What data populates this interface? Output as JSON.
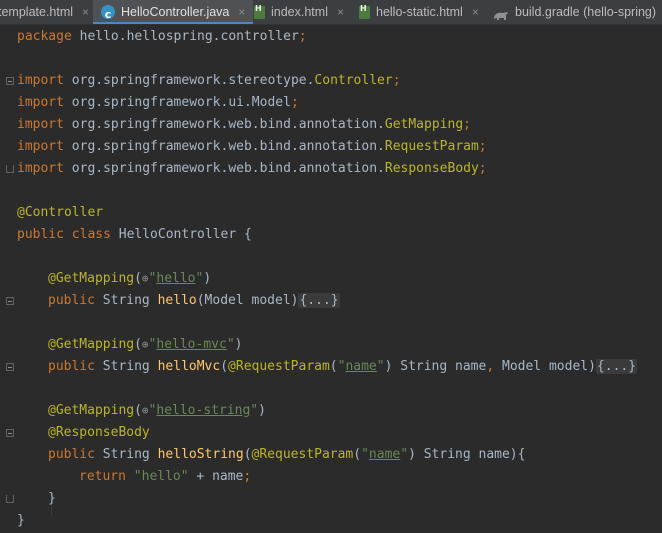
{
  "tabs": [
    {
      "label": "template.html",
      "icon": "html-file-icon",
      "active": false
    },
    {
      "label": "HelloController.java",
      "icon": "java-class-icon",
      "active": true
    },
    {
      "label": "index.html",
      "icon": "html-file-icon",
      "active": false
    },
    {
      "label": "hello-static.html",
      "icon": "html-file-icon",
      "active": false
    },
    {
      "label": "build.gradle (hello-spring)",
      "icon": "gradle-icon",
      "active": false
    }
  ],
  "close_glyph": "×",
  "code": {
    "package_kw": "package",
    "package_name": " hello.hellospring.controller",
    "semi": ";",
    "import_kw": "import",
    "imports": [
      {
        "pkg": " org.springframework.stereotype.",
        "cls": "Controller"
      },
      {
        "pkg": " org.springframework.ui.Model",
        "cls": ""
      },
      {
        "pkg": " org.springframework.web.bind.annotation.",
        "cls": "GetMapping"
      },
      {
        "pkg": " org.springframework.web.bind.annotation.",
        "cls": "RequestParam"
      },
      {
        "pkg": " org.springframework.web.bind.annotation.",
        "cls": "ResponseBody"
      }
    ],
    "controller_ann": "@Controller",
    "class_decl_kw": "public class",
    "class_name": " HelloController {",
    "getmapping": "@GetMapping",
    "open_paren": "(",
    "close_paren": ")",
    "globe": "⊕",
    "quote": "\"",
    "public_kw": "public",
    "string_type": " String ",
    "m1_path": "hello",
    "m1_name": "hello",
    "m1_params": "(Model model)",
    "collapsed_body": "{...}",
    "m2_path": "hello-mvc",
    "m2_name": "helloMvc",
    "requestparam": "@RequestParam",
    "name_param": "name",
    "m2_rest": ") String name",
    "comma": ",",
    "m2_model": " Model model)",
    "m3_path": "hello-string",
    "responsebody": "@ResponseBody",
    "m3_name": "helloString",
    "m3_rest": ") String name){",
    "return_kw": "return",
    "return_str": "\"hello\"",
    "return_rest": " + name",
    "close_brace": "}"
  }
}
